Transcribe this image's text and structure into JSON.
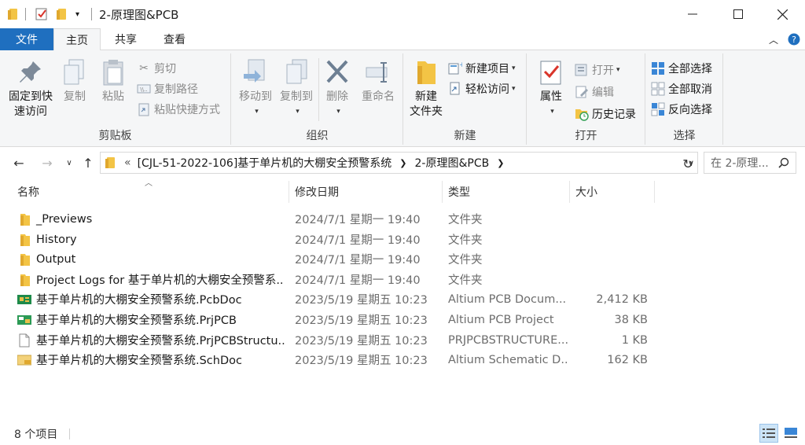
{
  "window": {
    "title": "2-原理图&PCB"
  },
  "ribbon_tabs": {
    "file": "文件",
    "home": "主页",
    "share": "共享",
    "view": "查看"
  },
  "clipboard": {
    "pin_line1": "固定到快",
    "pin_line2": "速访问",
    "copy": "复制",
    "paste": "粘贴",
    "cut": "剪切",
    "copy_path": "复制路径",
    "paste_shortcut": "粘贴快捷方式",
    "label": "剪贴板"
  },
  "organize": {
    "move_to": "移动到",
    "copy_to": "复制到",
    "delete": "删除",
    "rename": "重命名",
    "label": "组织"
  },
  "new": {
    "new_folder_line1": "新建",
    "new_folder_line2": "文件夹",
    "new_item": "新建项目",
    "easy_access": "轻松访问",
    "label": "新建"
  },
  "open": {
    "properties": "属性",
    "open": "打开",
    "edit": "编辑",
    "history": "历史记录",
    "label": "打开"
  },
  "select": {
    "select_all": "全部选择",
    "select_none": "全部取消",
    "invert": "反向选择",
    "label": "选择"
  },
  "address": {
    "crumb_overflow": "«",
    "crumb1": "[CJL-51-2022-106]基于单片机的大棚安全预警系统",
    "crumb2": "2-原理图&PCB",
    "search_placeholder": "在 2-原理..."
  },
  "columns": {
    "name": "名称",
    "date": "修改日期",
    "type": "类型",
    "size": "大小"
  },
  "files": [
    {
      "name": "_Previews",
      "date": "2024/7/1 星期一 19:40",
      "type": "文件夹",
      "size": "",
      "icon": "folder-icon"
    },
    {
      "name": "History",
      "date": "2024/7/1 星期一 19:40",
      "type": "文件夹",
      "size": "",
      "icon": "folder-icon"
    },
    {
      "name": "Output",
      "date": "2024/7/1 星期一 19:40",
      "type": "文件夹",
      "size": "",
      "icon": "folder-icon"
    },
    {
      "name": "Project Logs for 基于单片机的大棚安全预警系...",
      "date": "2024/7/1 星期一 19:40",
      "type": "文件夹",
      "size": "",
      "icon": "folder-icon"
    },
    {
      "name": "基于单片机的大棚安全预警系统.PcbDoc",
      "date": "2023/5/19 星期五 10:23",
      "type": "Altium PCB Docum...",
      "size": "2,412 KB",
      "icon": "pcbdoc-icon"
    },
    {
      "name": "基于单片机的大棚安全预警系统.PrjPCB",
      "date": "2023/5/19 星期五 10:23",
      "type": "Altium PCB Project",
      "size": "38 KB",
      "icon": "prjpcb-icon"
    },
    {
      "name": "基于单片机的大棚安全预警系统.PrjPCBStructu...",
      "date": "2023/5/19 星期五 10:23",
      "type": "PRJPCBSTRUCTURE...",
      "size": "1 KB",
      "icon": "blank-file-icon"
    },
    {
      "name": "基于单片机的大棚安全预警系统.SchDoc",
      "date": "2023/5/19 星期五 10:23",
      "type": "Altium Schematic D...",
      "size": "162 KB",
      "icon": "schdoc-icon"
    }
  ],
  "status": {
    "item_count": "8 个项目"
  },
  "colors": {
    "accent": "#1f6fbf",
    "folder": "#f3c445"
  }
}
